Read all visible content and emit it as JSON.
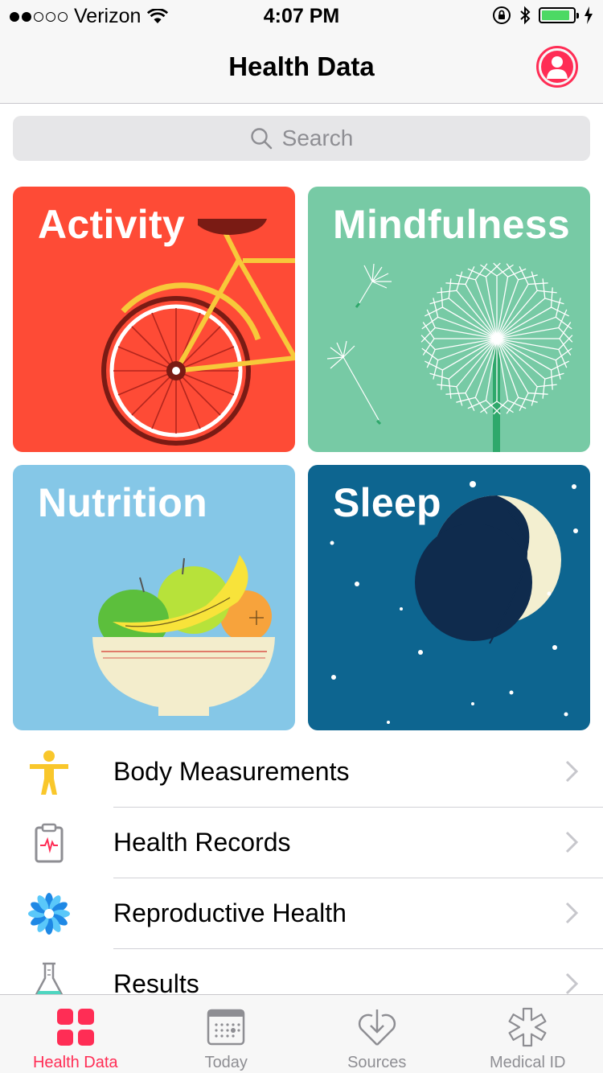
{
  "status_bar": {
    "carrier": "Verizon",
    "signal_bars": 2,
    "time": "4:07 PM",
    "battery_level": 0.9
  },
  "nav": {
    "title": "Health Data",
    "profile_icon": "person-icon"
  },
  "search": {
    "placeholder": "Search"
  },
  "categories": [
    {
      "label": "Activity",
      "color": "#fe4b36"
    },
    {
      "label": "Mindfulness",
      "color": "#77caa5"
    },
    {
      "label": "Nutrition",
      "color": "#85c7e7"
    },
    {
      "label": "Sleep",
      "color": "#0d6590"
    }
  ],
  "list": [
    {
      "label": "Body Measurements",
      "icon": "figure-icon"
    },
    {
      "label": "Health Records",
      "icon": "clipboard-icon"
    },
    {
      "label": "Reproductive Health",
      "icon": "flower-icon"
    },
    {
      "label": "Results",
      "icon": "flask-icon"
    }
  ],
  "tabs": [
    {
      "label": "Health Data",
      "icon": "grid-icon",
      "active": true
    },
    {
      "label": "Today",
      "icon": "calendar-icon",
      "active": false
    },
    {
      "label": "Sources",
      "icon": "heart-download-icon",
      "active": false
    },
    {
      "label": "Medical ID",
      "icon": "asterisk-icon",
      "active": false
    }
  ],
  "colors": {
    "accent": "#ff2d55",
    "secondary_text": "#8e8e93"
  }
}
